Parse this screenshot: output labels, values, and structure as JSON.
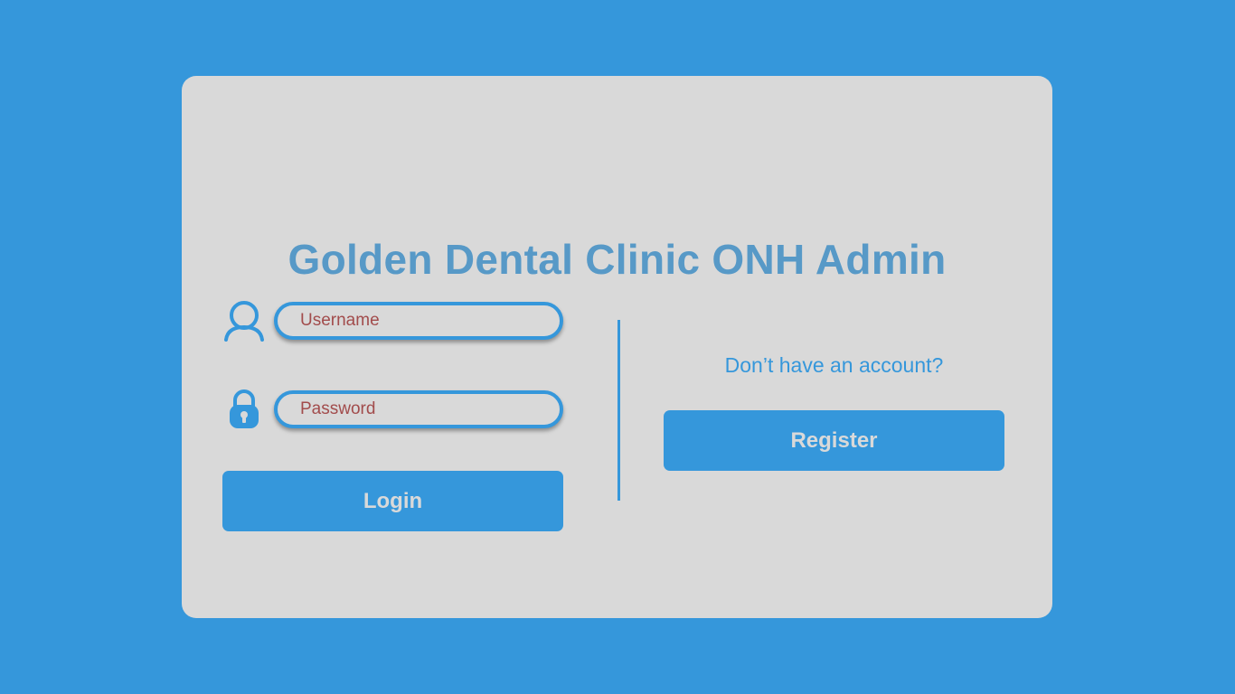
{
  "app": {
    "title": "Golden Dental Clinic ONH Admin"
  },
  "login": {
    "username": {
      "placeholder": "Username",
      "value": "",
      "icon": "user-icon"
    },
    "password": {
      "placeholder": "Password",
      "value": "",
      "icon": "padlock-icon"
    },
    "login_label": "Login"
  },
  "register": {
    "prompt": "Don’t have an account?",
    "register_label": "Register"
  },
  "colors": {
    "background": "#3597db",
    "card": "#d9d9d9",
    "title": "#5799c7",
    "accent": "#3597db",
    "placeholder": "#a24c4c",
    "button_text": "#d9d9d9"
  }
}
